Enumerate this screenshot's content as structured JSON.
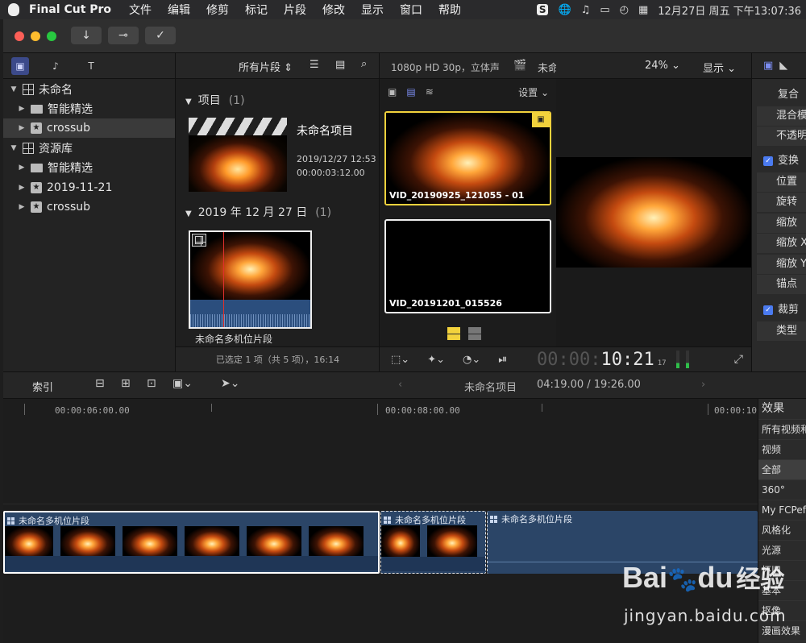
{
  "menubar": {
    "app": "Final Cut Pro",
    "items": [
      "文件",
      "编辑",
      "修剪",
      "标记",
      "片段",
      "修改",
      "显示",
      "窗口",
      "帮助"
    ],
    "status_s": "S",
    "datetime": "12月27日 周五 下午13:07:36"
  },
  "library": {
    "rows": [
      {
        "label": "未命名",
        "level": 0,
        "icon": "library-icon"
      },
      {
        "label": "智能精选",
        "level": 1,
        "icon": "folder-icon"
      },
      {
        "label": "crossub",
        "level": 1,
        "icon": "star-event-icon",
        "selected": true
      },
      {
        "label": "资源库",
        "level": 0,
        "icon": "library-icon"
      },
      {
        "label": "智能精选",
        "level": 1,
        "icon": "folder-icon"
      },
      {
        "label": "2019-11-21",
        "level": 1,
        "icon": "star-event-icon"
      },
      {
        "label": "crossub",
        "level": 1,
        "icon": "star-event-icon"
      }
    ]
  },
  "browser": {
    "filter": "所有片段",
    "section_projects": "项目",
    "section_projects_count": "(1)",
    "project_name": "未命名项目",
    "project_date": "2019/12/27 12:53",
    "project_duration": "00:00:03:12.00",
    "section_date": "2019 年 12 月 27 日",
    "section_date_count": "(1)",
    "clip_name": "未命名多机位片段",
    "status": "已选定 1 项（共 5 项），16:14"
  },
  "angle_viewer": {
    "format": "1080p HD 30p，立体声",
    "settings": "设置",
    "angles": [
      "VID_20190925_121055 - 01",
      "VID_20191201_015526"
    ]
  },
  "viewer": {
    "project": "未命名项目",
    "zoom": "24%",
    "display": "显示",
    "timecode_dim": "00:00:",
    "timecode_main": "10:21",
    "timecode_frames": "17"
  },
  "inspector": {
    "rows": [
      "复合",
      "混合模",
      "不透明",
      "变换",
      "位置",
      "旋转",
      "缩放",
      "缩放 X",
      "缩放 Y",
      "锚点",
      "裁剪",
      "类型"
    ]
  },
  "timeline": {
    "index": "索引",
    "project": "未命名项目",
    "position": "04:19.00 / 19:26.00",
    "ruler": [
      "00:00:06:00.00",
      "00:00:08:00.00",
      "00:00:10:"
    ],
    "clips": [
      "未命名多机位片段",
      "未命名多机位片段",
      "未命名多机位片段"
    ]
  },
  "effects": {
    "title": "效果",
    "items": [
      "所有视频和",
      "视频",
      "全部",
      "360°",
      "My FCPef",
      "风格化",
      "光源",
      "怀旧",
      "基本",
      "抠像",
      "漫画效果"
    ]
  },
  "watermark": {
    "brand": "Bai",
    "brand2": "du",
    "cn": "经验",
    "url": "jingyan.baidu.com"
  },
  "colors": {
    "accent": "#f2d23c",
    "clip": "#2b4567",
    "check": "#4b7bf0"
  }
}
